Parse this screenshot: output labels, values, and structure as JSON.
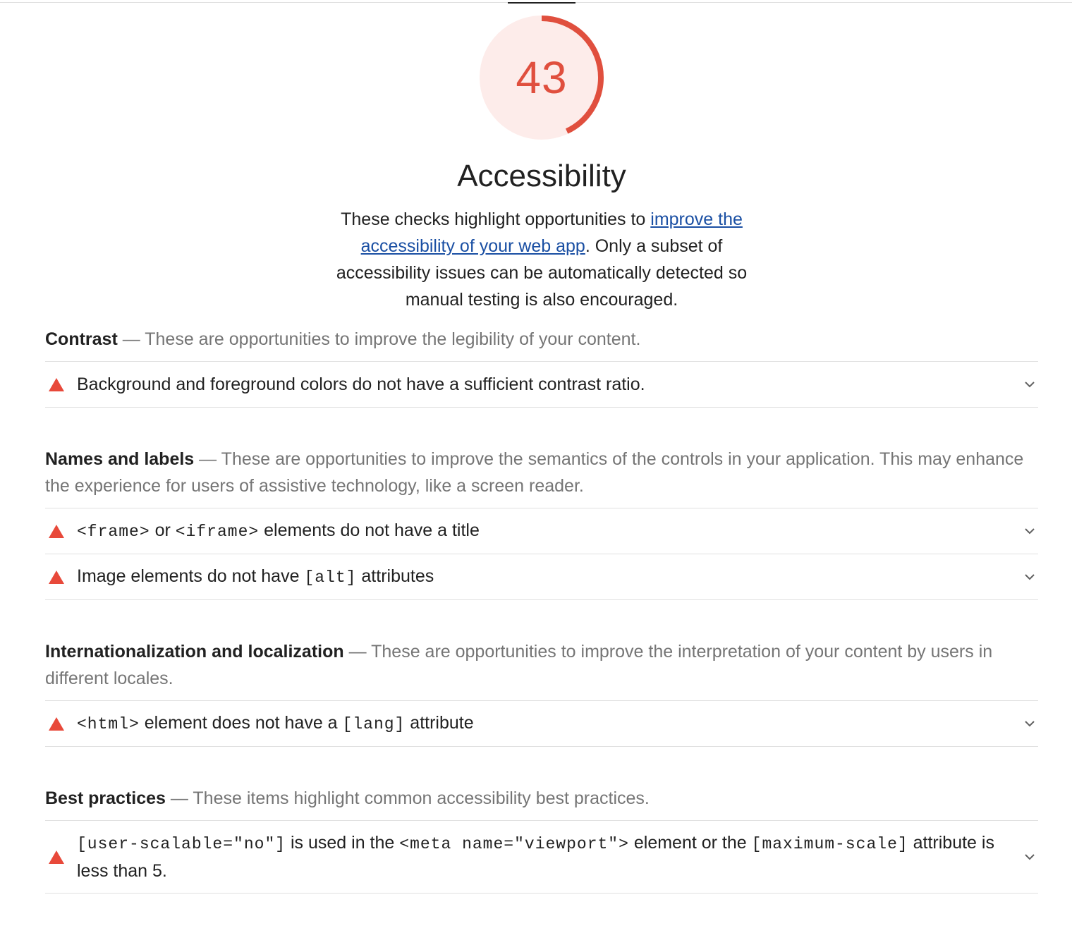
{
  "gauge": {
    "score": "43",
    "score_fraction": 0.43,
    "color": "#e04f3e",
    "fill_color": "#fdecea"
  },
  "category": {
    "title": "Accessibility",
    "desc_before": "These checks highlight opportunities to ",
    "desc_link": "improve the accessibility of your web app",
    "desc_after": ". Only a subset of accessibility issues can be automatically detected so manual testing is also encouraged."
  },
  "groups": [
    {
      "title": "Contrast",
      "separator": " — ",
      "description": "These are opportunities to improve the legibility of your content.",
      "audits": [
        {
          "parts": [
            {
              "t": "text",
              "v": "Background and foreground colors do not have a sufficient contrast ratio."
            }
          ],
          "icon": "fail-triangle-icon"
        }
      ]
    },
    {
      "title": "Names and labels",
      "separator": " — ",
      "description": "These are opportunities to improve the semantics of the controls in your application. This may enhance the experience for users of assistive technology, like a screen reader.",
      "audits": [
        {
          "parts": [
            {
              "t": "code",
              "v": "<frame>"
            },
            {
              "t": "text",
              "v": " or "
            },
            {
              "t": "code",
              "v": "<iframe>"
            },
            {
              "t": "text",
              "v": " elements do not have a title"
            }
          ],
          "icon": "fail-triangle-icon"
        },
        {
          "parts": [
            {
              "t": "text",
              "v": "Image elements do not have "
            },
            {
              "t": "code",
              "v": "[alt]"
            },
            {
              "t": "text",
              "v": " attributes"
            }
          ],
          "icon": "fail-triangle-icon"
        }
      ]
    },
    {
      "title": "Internationalization and localization",
      "separator": " — ",
      "description": "These are opportunities to improve the interpretation of your content by users in different locales.",
      "audits": [
        {
          "parts": [
            {
              "t": "code",
              "v": "<html>"
            },
            {
              "t": "text",
              "v": " element does not have a "
            },
            {
              "t": "code",
              "v": "[lang]"
            },
            {
              "t": "text",
              "v": " attribute"
            }
          ],
          "icon": "fail-triangle-icon"
        }
      ]
    },
    {
      "title": "Best practices",
      "separator": " — ",
      "description": "These items highlight common accessibility best practices.",
      "audits": [
        {
          "parts": [
            {
              "t": "code",
              "v": "[user-scalable=\"no\"]"
            },
            {
              "t": "text",
              "v": " is used in the "
            },
            {
              "t": "code",
              "v": "<meta name=\"viewport\">"
            },
            {
              "t": "text",
              "v": " element or the "
            },
            {
              "t": "code",
              "v": "[maximum-scale]"
            },
            {
              "t": "text",
              "v": " attribute is less than 5."
            }
          ],
          "icon": "fail-triangle-icon",
          "tall": true
        }
      ]
    }
  ],
  "icons": {
    "expand": "chevron-down-icon",
    "fail": "fail-triangle-icon"
  }
}
